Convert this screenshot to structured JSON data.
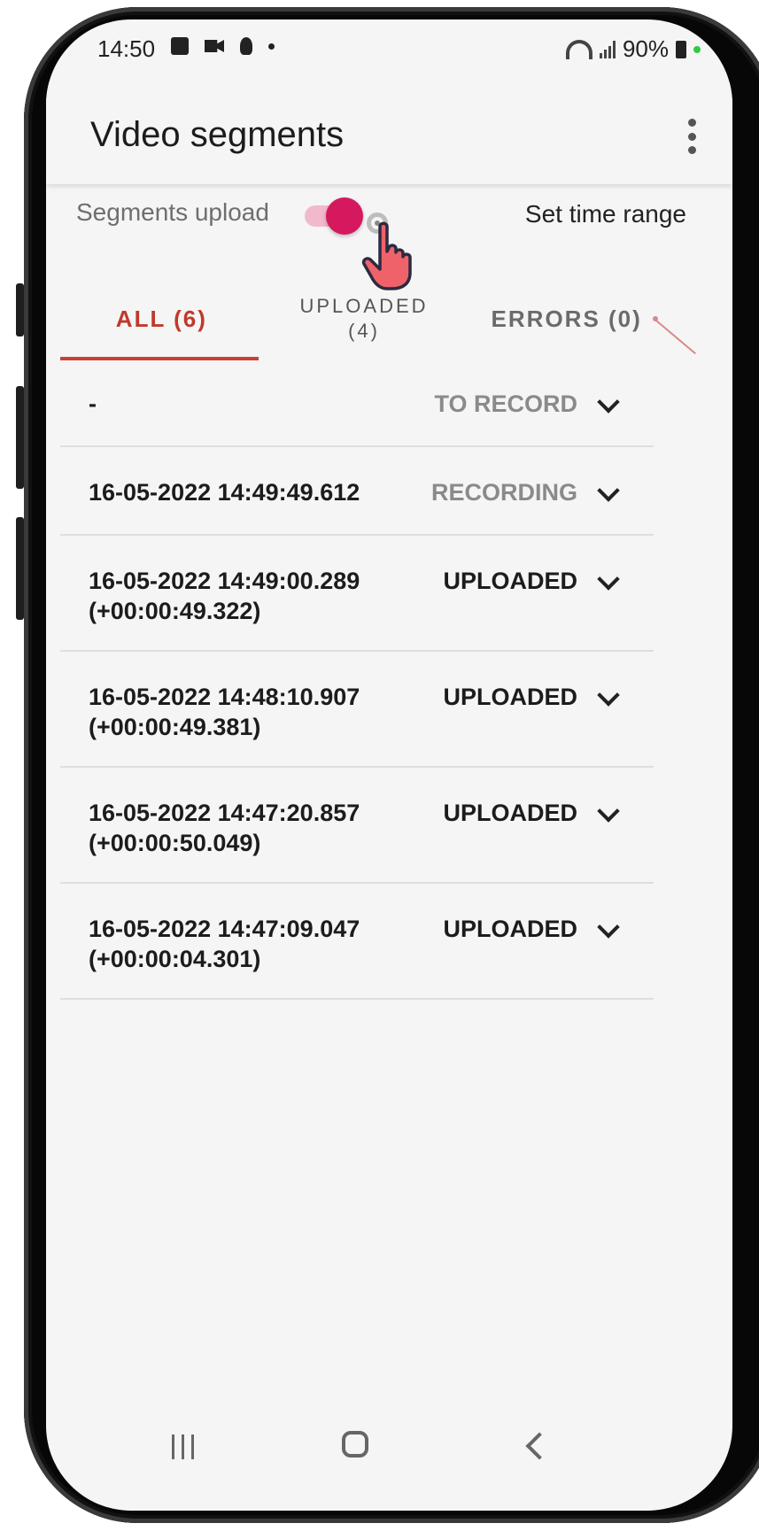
{
  "status_bar": {
    "time": "14:50",
    "battery": "90%"
  },
  "app_bar": {
    "title": "Video segments"
  },
  "controls": {
    "upload_label": "Segments upload",
    "upload_enabled": true,
    "time_range_label": "Set time range"
  },
  "tabs": [
    {
      "label": "ALL (6)",
      "active": true
    },
    {
      "label": "UPLOADED\n(4)",
      "active": false
    },
    {
      "label": "ERRORS (0)",
      "active": false
    }
  ],
  "segments": [
    {
      "date": "-",
      "duration": "",
      "status": "TO RECORD"
    },
    {
      "date": "16-05-2022 14:49:49.612",
      "duration": "",
      "status": "RECORDING"
    },
    {
      "date": "16-05-2022 14:49:00.289",
      "duration": "(+00:00:49.322)",
      "status": "UPLOADED"
    },
    {
      "date": "16-05-2022 14:48:10.907",
      "duration": "(+00:00:49.381)",
      "status": "UPLOADED"
    },
    {
      "date": "16-05-2022 14:47:20.857",
      "duration": "(+00:00:50.049)",
      "status": "UPLOADED"
    },
    {
      "date": "16-05-2022 14:47:09.047",
      "duration": "(+00:00:04.301)",
      "status": "UPLOADED"
    }
  ],
  "colors": {
    "accent": "#c94032",
    "toggle_knob": "#d6195e",
    "toggle_track": "#f2b9cc"
  }
}
